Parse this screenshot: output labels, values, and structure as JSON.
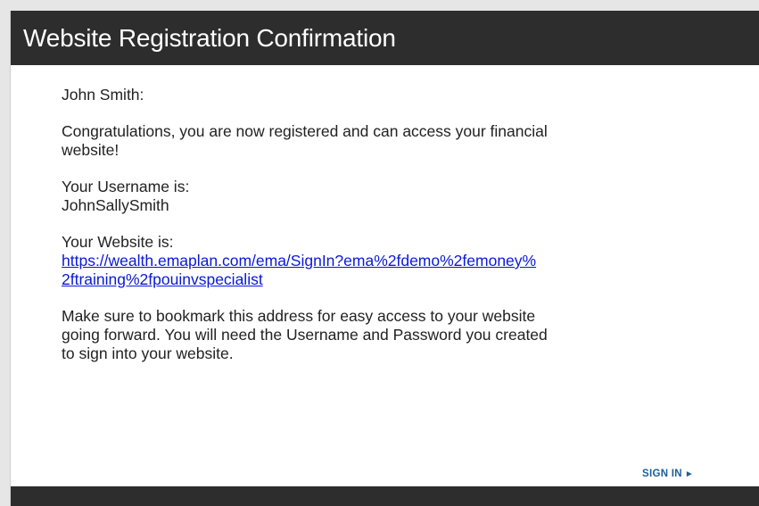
{
  "header": {
    "title": "Website Registration Confirmation"
  },
  "message": {
    "greeting": "John Smith:",
    "congrats_line1": "Congratulations, you are now registered and can access your financial",
    "congrats_line2": "website!",
    "username_label": "Your Username is:",
    "username_value": "JohnSallySmith",
    "website_label": "Your Website is:",
    "website_url_line1": "https://wealth.emaplan.com/ema/SignIn?ema%2fdemo%2femoney%",
    "website_url_line2": "2ftraining%2fpouinvspecialist",
    "note_line1": "Make sure to bookmark this address for easy access to your website",
    "note_line2": "going forward. You will need the Username and Password you created",
    "note_line3": "to sign into your website."
  },
  "actions": {
    "sign_in_label": "SIGN IN",
    "sign_in_arrow": "►"
  },
  "colors": {
    "header_bg": "#2d2d2d",
    "link": "#0a18d8",
    "sign_in": "#1c5e98"
  }
}
